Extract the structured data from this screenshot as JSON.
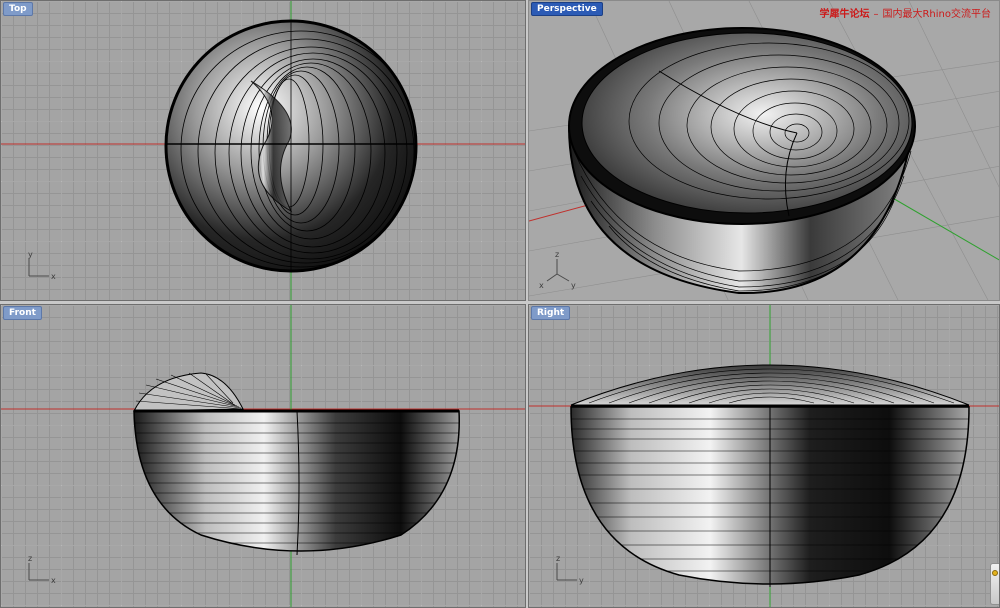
{
  "viewports": {
    "top": {
      "label": "Top",
      "active": false
    },
    "perspective": {
      "label": "Perspective",
      "active": true
    },
    "front": {
      "label": "Front",
      "active": false
    },
    "right": {
      "label": "Right",
      "active": false
    }
  },
  "axes": {
    "top": {
      "vertical": "y",
      "horizontal": "x"
    },
    "perspective": {
      "up": "z",
      "left": "x",
      "right": "y"
    },
    "front": {
      "vertical": "z",
      "horizontal": "x"
    },
    "right": {
      "vertical": "z",
      "horizontal": "y"
    }
  },
  "watermark": {
    "site": "学犀牛论坛",
    "separator": "–",
    "description": "国内最大Rhino交流平台"
  },
  "colors": {
    "viewport_bg": "#a4a4a4",
    "grid_x_axis": "#c0302c",
    "grid_y_axis": "#2ea12e",
    "active_label": "#2c5bb5",
    "inactive_label": "#7f9bc9",
    "watermark": "#cc1a1a"
  },
  "icons": {
    "axis_gizmo": "axis-gizmo-icon",
    "corner_badge": "notification-badge-icon"
  }
}
